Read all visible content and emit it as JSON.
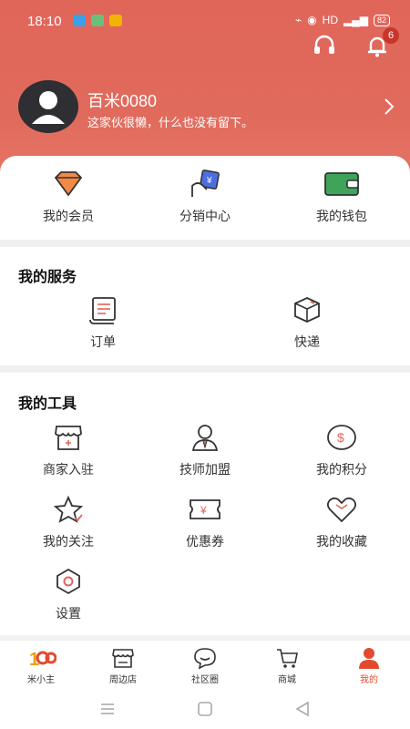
{
  "status": {
    "time": "18:10",
    "right_text": "HD",
    "battery": "82"
  },
  "header": {
    "notification_count": "6"
  },
  "profile": {
    "name": "百米0080",
    "bio": "这家伙很懒，什么也没有留下。"
  },
  "top_actions": [
    {
      "label": "我的会员",
      "icon": "diamond-icon"
    },
    {
      "label": "分销中心",
      "icon": "distribution-icon"
    },
    {
      "label": "我的钱包",
      "icon": "wallet-icon"
    }
  ],
  "services": {
    "title": "我的服务",
    "items": [
      {
        "label": "订单",
        "icon": "order-icon"
      },
      {
        "label": "快递",
        "icon": "package-icon"
      }
    ]
  },
  "tools": {
    "title": "我的工具",
    "items": [
      {
        "label": "商家入驻",
        "icon": "shop-icon"
      },
      {
        "label": "技师加盟",
        "icon": "technician-icon"
      },
      {
        "label": "我的积分",
        "icon": "points-icon"
      },
      {
        "label": "我的关注",
        "icon": "star-icon"
      },
      {
        "label": "优惠券",
        "icon": "coupon-icon"
      },
      {
        "label": "我的收藏",
        "icon": "heart-icon"
      },
      {
        "label": "设置",
        "icon": "settings-icon"
      }
    ]
  },
  "tabbar": [
    {
      "label": "米小主",
      "icon": "home-icon"
    },
    {
      "label": "周边店",
      "icon": "store-icon"
    },
    {
      "label": "社区圈",
      "icon": "chat-icon"
    },
    {
      "label": "商城",
      "icon": "cart-icon"
    },
    {
      "label": "我的",
      "icon": "profile-icon",
      "active": true
    }
  ],
  "colors": {
    "header": "#e0665a",
    "accent": "#e24a2f",
    "badge": "#c9352b"
  }
}
